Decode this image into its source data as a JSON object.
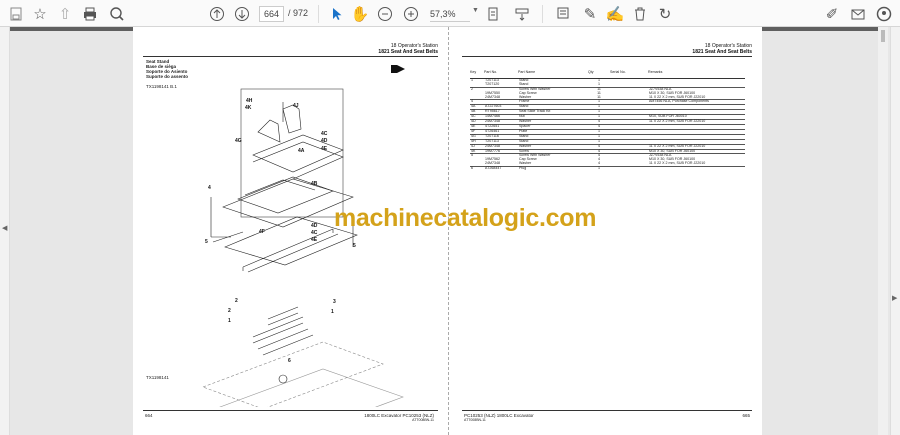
{
  "toolbar": {
    "page_current": "664",
    "page_total": "/ 972",
    "zoom": "57,3%",
    "icons": [
      "save-icon",
      "bookmark-star-icon",
      "upload-icon",
      "print-icon",
      "search-zoom-icon",
      "prev-page-icon",
      "next-page-icon",
      "select-cursor-icon",
      "hand-icon",
      "zoom-out-icon",
      "zoom-in-icon",
      "page-fit-icon",
      "scroll-mode-icon",
      "comment-icon",
      "pen-icon",
      "sign-icon",
      "delete-icon",
      "rotate-icon",
      "share-sign-icon",
      "email-icon",
      "account-icon"
    ]
  },
  "left_page": {
    "header_line1": "18 Operator's Station",
    "header_line2": "1821 Seat And Seat Belts",
    "title_lines": [
      "Seat Stand",
      "Base de sièga",
      "Soporte do Asiento",
      "Suporte do assento"
    ],
    "figure_id": "TX1198141 B.1",
    "figure_code": "TX1198141",
    "callouts": [
      "4H",
      "4K",
      "4J",
      "4G",
      "4A",
      "4C",
      "4D",
      "4E",
      "4",
      "4B",
      "5",
      "4F",
      "4D",
      "4C",
      "4E",
      "2",
      "3",
      "1",
      "6",
      "2",
      "5",
      "1"
    ],
    "page_number": "664",
    "footer_text": "1800LC Excavator  PC10253  (NLZ)",
    "footer_sub": "ATT008BN-11"
  },
  "right_page": {
    "header_line1": "18 Operator's Station",
    "header_line2": "1821 Seat And Seat Belts",
    "columns": [
      "Key",
      "Part No.",
      "Part Name",
      "Qty",
      "Serial No.",
      "Remarks"
    ],
    "rows": [
      [
        "1",
        "T207113",
        "Stand",
        "1",
        "",
        ""
      ],
      [
        "",
        "T207120",
        "Stand",
        "1",
        "",
        ""
      ],
      [
        "2",
        "",
        "Screw With Washer",
        "11",
        "",
        "JZ7V538 NLA"
      ],
      [
        "",
        "19M7550",
        "Cap Screw",
        "11",
        "",
        "M10 X 30, SUB FOR J60100"
      ],
      [
        "",
        "24M7348",
        "Washer",
        "11",
        "",
        "11 X 22 X 2 mm, SUB FOR J22010"
      ],
      [
        "4",
        "",
        "Frame",
        "1",
        "",
        "AM7456 NLA, Purchase Components"
      ],
      [
        "4A",
        "AT227603",
        "Stand",
        "1",
        "",
        ""
      ],
      [
        "4B",
        "RT95617",
        "Seat Slide Track Kit",
        "1",
        "",
        ""
      ],
      [
        "4C",
        "14M7466",
        "Nut",
        "1",
        "",
        "M10, SUB FOR J60010"
      ],
      [
        "4D",
        "24M7348",
        "Washer",
        "4",
        "",
        "11 X 22 X 2 mm, SUB FOR J22010"
      ],
      [
        "4E",
        "4T22651",
        "Spacer",
        "4",
        "",
        ""
      ],
      [
        "4F",
        "4T26461",
        "Plate",
        "1",
        "",
        ""
      ],
      [
        "4G",
        "T207116",
        "Stand",
        "1",
        "",
        ""
      ],
      [
        "4H",
        "T207113",
        "Stand",
        "1",
        "",
        ""
      ],
      [
        "4J",
        "24M7348",
        "Washer",
        "4",
        "",
        "11 X 22 X 2 mm, SUB FOR J22010"
      ],
      [
        "4K",
        "19M7776",
        "Screw",
        "4",
        "",
        "M10 X 30, SUB FOR J60100"
      ],
      [
        "5",
        "",
        "Screw With Washer",
        "4",
        "",
        "JZ7V538 NLA"
      ],
      [
        "",
        "19M7562",
        "Cap Screw",
        "4",
        "",
        "M10 X 30, SUB FOR J60100"
      ],
      [
        "",
        "24M7348",
        "Washer",
        "4",
        "",
        "11 X 22 X 2 mm, SUB FOR J22010"
      ],
      [
        "6",
        "AT268447",
        "Plug",
        "1",
        "",
        ""
      ]
    ],
    "page_number": "665",
    "footer_text": "PC10253  (NLZ)  1800LC Excavator",
    "footer_sub": "ATT008BN-11"
  },
  "watermark": "machinecatalogic.com"
}
